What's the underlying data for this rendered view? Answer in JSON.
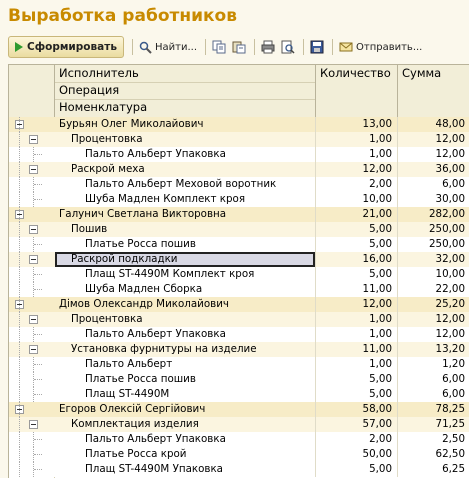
{
  "title": "Выработка работников",
  "toolbar": {
    "generate_label": "Сформировать",
    "find_label": "Найти...",
    "send_label": "Отправить..."
  },
  "columns": {
    "performer": "Исполнитель",
    "operation": "Операция",
    "item": "Номенклатура",
    "quantity": "Количество",
    "sum": "Сумма"
  },
  "rows": [
    {
      "name": "Бурьян Олег Миколайович",
      "qty": "13,00",
      "sum": "48,00"
    },
    {
      "name": "Процентовка",
      "qty": "1,00",
      "sum": "12,00"
    },
    {
      "name": "Пальто Альберт Упаковка",
      "qty": "1,00",
      "sum": "12,00"
    },
    {
      "name": "Раскрой меха",
      "qty": "12,00",
      "sum": "36,00"
    },
    {
      "name": "Пальто Альберт Меховой воротник",
      "qty": "2,00",
      "sum": "6,00"
    },
    {
      "name": "Шуба Мадлен Комплект кроя",
      "qty": "10,00",
      "sum": "30,00"
    },
    {
      "name": "Галунич Светлана Викторовна",
      "qty": "21,00",
      "sum": "282,00"
    },
    {
      "name": "Пошив",
      "qty": "5,00",
      "sum": "250,00"
    },
    {
      "name": "Платье Росса пошив",
      "qty": "5,00",
      "sum": "250,00"
    },
    {
      "name": "Раскрой подкладки",
      "qty": "16,00",
      "sum": "32,00"
    },
    {
      "name": "Плащ ST-4490M Комплект кроя",
      "qty": "5,00",
      "sum": "10,00"
    },
    {
      "name": "Шуба Мадлен Сборка",
      "qty": "11,00",
      "sum": "22,00"
    },
    {
      "name": "Дімов Олександр Миколайович",
      "qty": "12,00",
      "sum": "25,20"
    },
    {
      "name": "Процентовка",
      "qty": "1,00",
      "sum": "12,00"
    },
    {
      "name": "Пальто Альберт Упаковка",
      "qty": "1,00",
      "sum": "12,00"
    },
    {
      "name": "Установка фурнитуры на изделие",
      "qty": "11,00",
      "sum": "13,20"
    },
    {
      "name": "Пальто Альберт",
      "qty": "1,00",
      "sum": "1,20"
    },
    {
      "name": "Платье Росса пошив",
      "qty": "5,00",
      "sum": "6,00"
    },
    {
      "name": "Плащ ST-4490M",
      "qty": "5,00",
      "sum": "6,00"
    },
    {
      "name": "Егоров Олексій Сергійович",
      "qty": "58,00",
      "sum": "78,25"
    },
    {
      "name": "Комплектация изделия",
      "qty": "57,00",
      "sum": "71,25"
    },
    {
      "name": "Пальто Альберт Упаковка",
      "qty": "2,00",
      "sum": "2,50"
    },
    {
      "name": "Платье Росса крой",
      "qty": "50,00",
      "sum": "62,50"
    },
    {
      "name": "Плащ ST-4490M Упаковка",
      "qty": "5,00",
      "sum": "6,25"
    }
  ],
  "icons": [
    "play-icon",
    "find-icon",
    "copy-icon",
    "paste-icon",
    "print-icon",
    "preview-icon",
    "save-icon",
    "envelope-icon"
  ],
  "colors": {
    "title": "#c88a00",
    "level0": "#f7ecc7",
    "level1": "#fbf5e0"
  }
}
